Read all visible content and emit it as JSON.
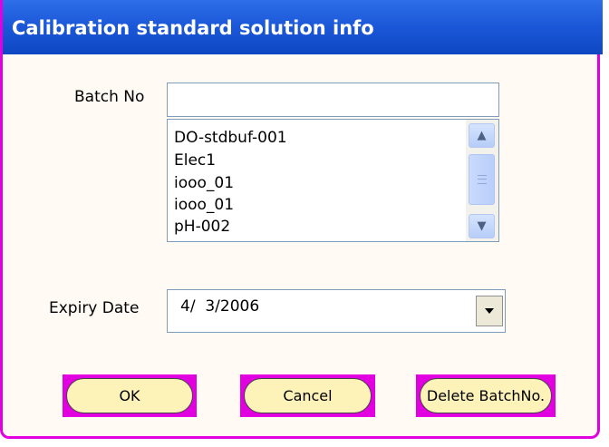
{
  "dialog": {
    "title": "Calibration standard solution info",
    "batch_label": "Batch No",
    "batch_value": "",
    "batch_list": [
      "DO-stdbuf-001",
      "Elec1",
      "iooo_01",
      "iooo_01",
      "pH-002"
    ],
    "expiry_label": "Expiry Date",
    "expiry_value": "4/  3/2006",
    "ok_label": "OK",
    "cancel_label": "Cancel",
    "delete_label": "Delete BatchNo."
  },
  "colors": {
    "title_bar": "#1a57d8",
    "border": "#e000e0",
    "button_fill": "#fdf2b8",
    "background": "#fffaf4"
  }
}
